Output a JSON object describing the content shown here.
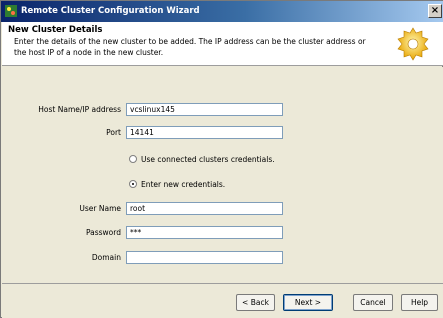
{
  "window": {
    "title": "Remote Cluster Configuration Wizard",
    "close_glyph": "×"
  },
  "header": {
    "title": "New Cluster Details",
    "description": "Enter the details of the new cluster to be added. The IP address can be the cluster address or the host IP of a node in the new cluster."
  },
  "form": {
    "host_label": "Host Name/IP address",
    "host_value": "vcslinux145",
    "port_label": "Port",
    "port_value": "14141",
    "option_connected": "Use connected clusters credentials.",
    "option_new": "Enter new credentials.",
    "selected_option": "new",
    "user_label": "User Name",
    "user_value": "root",
    "password_label": "Password",
    "password_value": "***",
    "domain_label": "Domain",
    "domain_value": ""
  },
  "buttons": {
    "back": "< Back",
    "next": "Next >",
    "cancel": "Cancel",
    "help": "Help"
  }
}
